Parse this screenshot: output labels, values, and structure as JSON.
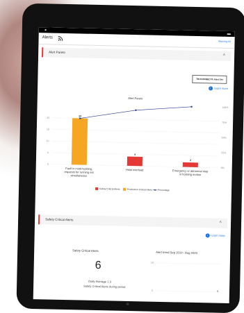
{
  "status": {
    "left": "◂",
    "right": "▬"
  },
  "header": {
    "title": "Alerts",
    "link": "Warning All"
  },
  "pareto": {
    "section_title": "Alert Pareto",
    "alert_set": "TRUCONNECT® Alert Set",
    "learn_more": "Learn more"
  },
  "chart_data": {
    "type": "bar",
    "title": "Alert Pareto",
    "categories": [
      [
        "Fault in multi-hoisting,",
        "requests for running not",
        "simultaneous"
      ],
      [
        "Hoist overload"
      ],
      [
        "Emergency or abnormal stop",
        "in hoisting motion"
      ]
    ],
    "values": [
      20,
      4,
      2
    ],
    "value_labels": [
      "20",
      "4",
      "2"
    ],
    "bar_colors": [
      "#f5a623",
      "#e53935",
      "#e53935"
    ],
    "percentage": [
      76.9,
      92.3,
      100
    ],
    "ylim": [
      0,
      26
    ],
    "y_ticks": [
      "0",
      "5",
      "10",
      "15",
      "20"
    ],
    "y2_ticks": [
      "0%",
      "25%",
      "50%",
      "75%",
      "100%"
    ],
    "legend": [
      "Safety Critical Alerts",
      "Production Critical Alerts",
      "Percentage"
    ],
    "line_color": "#283593"
  },
  "safety": {
    "section_title": "Safety Critical Alerts",
    "learn_more": "Learn more",
    "panel_title": "Safety Critical Alerts",
    "count": "6",
    "daily_average": "Daily Average 1.3",
    "daily_sub": "Safety Critical Alerts during period",
    "trend_title": "Alert trend Sep 2019 - Aug 2020",
    "trend_ticks": [
      "10",
      "5"
    ],
    "trend_value": "4"
  }
}
